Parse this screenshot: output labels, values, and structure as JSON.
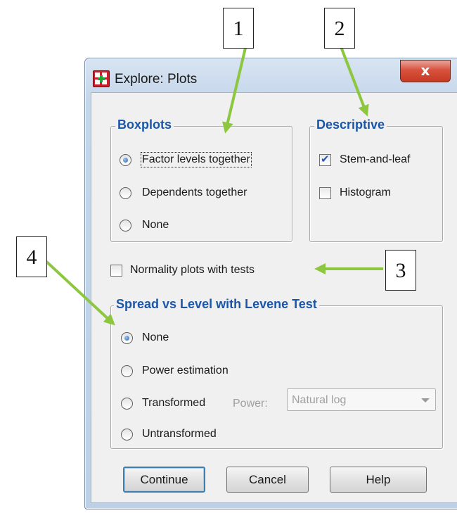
{
  "window": {
    "title": "Explore: Plots",
    "close_glyph": "x"
  },
  "boxplots": {
    "legend": "Boxplots",
    "options": [
      "Factor levels together",
      "Dependents together",
      "None"
    ],
    "selected": 0
  },
  "descriptive": {
    "legend": "Descriptive",
    "stem_and_leaf": "Stem-and-leaf",
    "stem_and_leaf_checked": true,
    "histogram": "Histogram",
    "histogram_checked": false
  },
  "normality": {
    "label": "Normality plots with tests",
    "checked": false
  },
  "spread": {
    "legend": "Spread vs Level with Levene Test",
    "options": [
      "None",
      "Power estimation",
      "Transformed",
      "Untransformed"
    ],
    "selected": 0,
    "power_label": "Power:",
    "power_value": "Natural log"
  },
  "buttons": {
    "continue": "Continue",
    "cancel": "Cancel",
    "help": "Help"
  },
  "callouts": [
    "1",
    "2",
    "3",
    "4"
  ],
  "colors": {
    "legend_text": "#1b56a8",
    "annotation_arrow": "#8dc63f",
    "close_button": "#d8523d"
  },
  "icons": [
    "spss-app-icon",
    "close-icon",
    "dropdown-arrow-icon"
  ]
}
